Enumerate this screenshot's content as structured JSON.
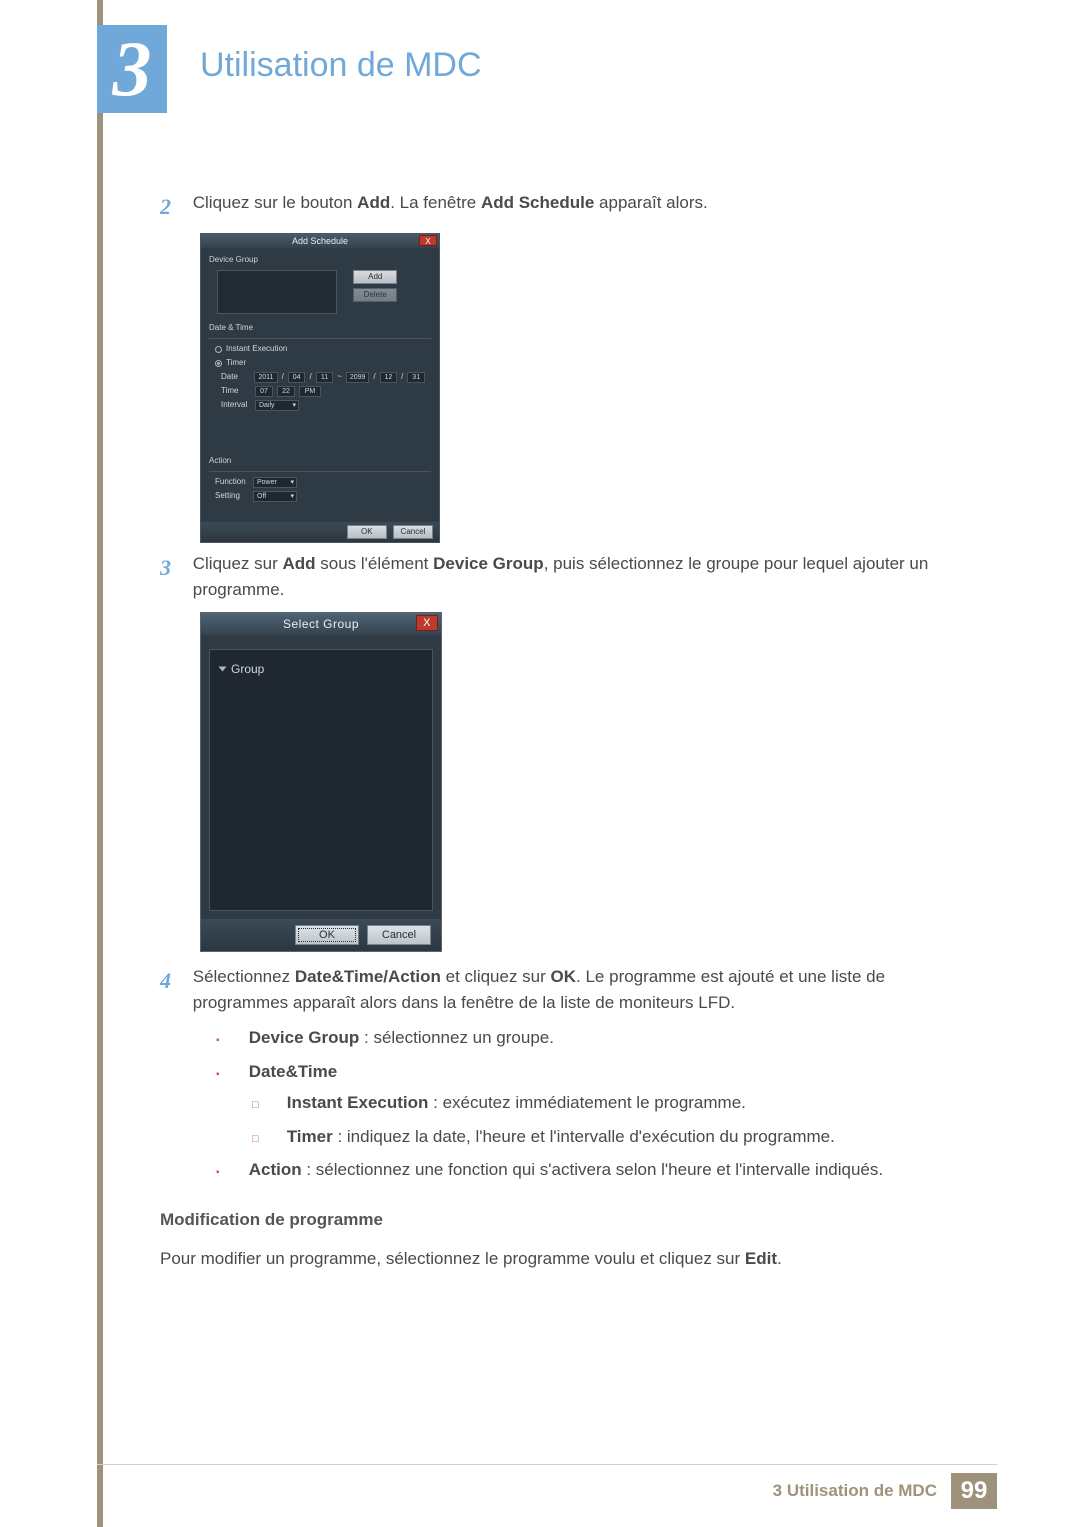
{
  "chapter": {
    "number": "3",
    "title": "Utilisation de MDC"
  },
  "steps": {
    "s2": {
      "num": "2",
      "pre": "Cliquez sur le bouton ",
      "b1": "Add",
      "mid": ". La fenêtre ",
      "b2": "Add Schedule",
      "post": " apparaît alors."
    },
    "s3": {
      "num": "3",
      "pre": "Cliquez sur ",
      "b1": "Add",
      "mid": " sous l'élément ",
      "b2": "Device Group",
      "post": ", puis sélectionnez le groupe pour lequel ajouter un programme."
    },
    "s4": {
      "num": "4",
      "pre": "Sélectionnez ",
      "b1": "Date&Time/Action",
      "mid": " et cliquez sur ",
      "b2": "OK",
      "post": ". Le programme est ajouté et une liste de programmes apparaît alors dans la fenêtre de la liste de moniteurs LFD."
    }
  },
  "add_dialog": {
    "title": "Add Schedule",
    "device_group_label": "Device Group",
    "add_btn": "Add",
    "delete_btn": "Delete",
    "datetime_label": "Date & Time",
    "instant_label": "Instant Execution",
    "timer_label": "Timer",
    "date_label": "Date",
    "date_from_y": "2011",
    "date_from_m": "04",
    "date_from_d": "11",
    "date_sep": "~",
    "date_to_y": "2099",
    "date_to_m": "12",
    "date_to_d": "31",
    "time_label": "Time",
    "time_h": "07",
    "time_m": "22",
    "time_ampm": "PM",
    "interval_label": "Interval",
    "interval_val": "Daily",
    "action_label": "Action",
    "function_label": "Function",
    "function_val": "Power",
    "setting_label": "Setting",
    "setting_val": "Off",
    "ok": "OK",
    "cancel": "Cancel"
  },
  "select_dialog": {
    "title": "Select Group",
    "root": "Group",
    "ok": "OK",
    "cancel": "Cancel"
  },
  "bullets": {
    "device_group": {
      "label": "Device Group",
      "desc": " : sélectionnez un groupe."
    },
    "date_time_label": "Date&Time",
    "instant": {
      "label": "Instant Execution",
      "desc": " : exécutez immédiatement le programme."
    },
    "timer": {
      "label": "Timer",
      "desc": " : indiquez la date, l'heure et l'intervalle d'exécution du programme."
    },
    "action": {
      "label": "Action",
      "desc": " : sélectionnez une fonction qui s'activera selon l'heure et l'intervalle indiqués."
    }
  },
  "mod_section": {
    "heading": "Modification de programme",
    "text_pre": "Pour modifier un programme, sélectionnez le programme voulu et cliquez sur ",
    "text_bold": "Edit",
    "text_post": "."
  },
  "footer": {
    "text": "3 Utilisation de MDC",
    "page": "99"
  }
}
